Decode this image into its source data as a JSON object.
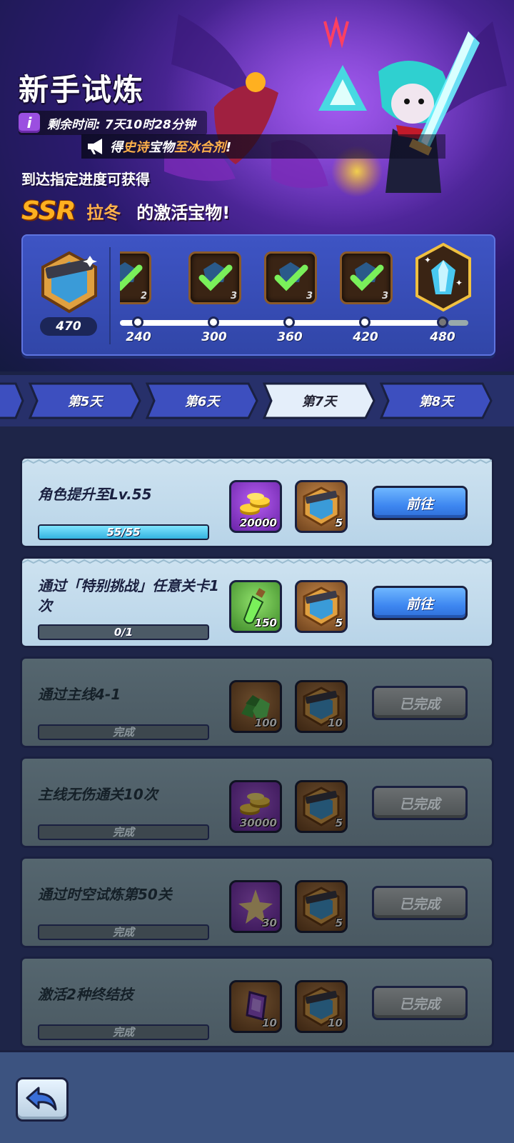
{
  "banner": {
    "title": "新手试炼",
    "info_icon_letter": "i",
    "timer": "剩余时间: 7天10时28分钟",
    "notice": {
      "prefix": "得",
      "highlight1": "史诗",
      "middle": "宝物",
      "highlight2": "至冰合剂",
      "suffix": "!"
    },
    "progress_hint": "到达指定进度可获得",
    "ssr_badge": "SSR",
    "hero_name": "拉冬",
    "ssr_suffix": "的激活宝物!"
  },
  "milestones": {
    "current_points": "470",
    "items": [
      {
        "threshold": "240",
        "qty": "2",
        "claimed": true
      },
      {
        "threshold": "300",
        "qty": "3",
        "claimed": true
      },
      {
        "threshold": "360",
        "qty": "3",
        "claimed": true
      },
      {
        "threshold": "420",
        "qty": "3",
        "claimed": true
      },
      {
        "threshold": "480",
        "qty": "",
        "claimed": false
      }
    ]
  },
  "day_tabs": [
    {
      "label": "第5天",
      "active": false
    },
    {
      "label": "第6天",
      "active": false
    },
    {
      "label": "第7天",
      "active": true
    },
    {
      "label": "第8天",
      "active": false
    }
  ],
  "tasks": [
    {
      "name": "角色提升至Lv.55",
      "progress_text": "55/55",
      "progress": 1.0,
      "state": "open",
      "reward1": {
        "icon": "gold-coins-icon",
        "qty": "20000"
      },
      "reward2": {
        "icon": "shield-token-icon",
        "qty": "5"
      },
      "button": "前往"
    },
    {
      "name": "通过「特别挑战」任意关卡1次",
      "progress_text": "0/1",
      "progress": 0.0,
      "state": "open",
      "reward1": {
        "icon": "potion-icon",
        "qty": "150"
      },
      "reward2": {
        "icon": "shield-token-icon",
        "qty": "5"
      },
      "button": "前往"
    },
    {
      "name": "通过主线4-1",
      "progress_text": "完成",
      "progress": 1.0,
      "state": "done",
      "reward1": {
        "icon": "green-ore-icon",
        "qty": "100"
      },
      "reward2": {
        "icon": "shield-token-icon",
        "qty": "10"
      },
      "button": "已完成"
    },
    {
      "name": "主线无伤通关10次",
      "progress_text": "完成",
      "progress": 1.0,
      "state": "done",
      "reward1": {
        "icon": "gold-coins-icon",
        "qty": "30000"
      },
      "reward2": {
        "icon": "shield-token-icon",
        "qty": "5"
      },
      "button": "已完成"
    },
    {
      "name": "通过时空试炼第50关",
      "progress_text": "完成",
      "progress": 1.0,
      "state": "done",
      "reward1": {
        "icon": "star-shard-icon",
        "qty": "30"
      },
      "reward2": {
        "icon": "shield-token-icon",
        "qty": "5"
      },
      "button": "已完成"
    },
    {
      "name": "激活2种终结技",
      "progress_text": "完成",
      "progress": 1.0,
      "state": "done",
      "reward1": {
        "icon": "purple-gem-icon",
        "qty": "10"
      },
      "reward2": {
        "icon": "shield-token-icon",
        "qty": "10"
      },
      "button": "已完成"
    }
  ],
  "colors": {
    "accent_orange": "#ffb14a",
    "button_blue": "#3d86f0",
    "card_open": "#cde2f0",
    "card_done": "#55666f"
  }
}
